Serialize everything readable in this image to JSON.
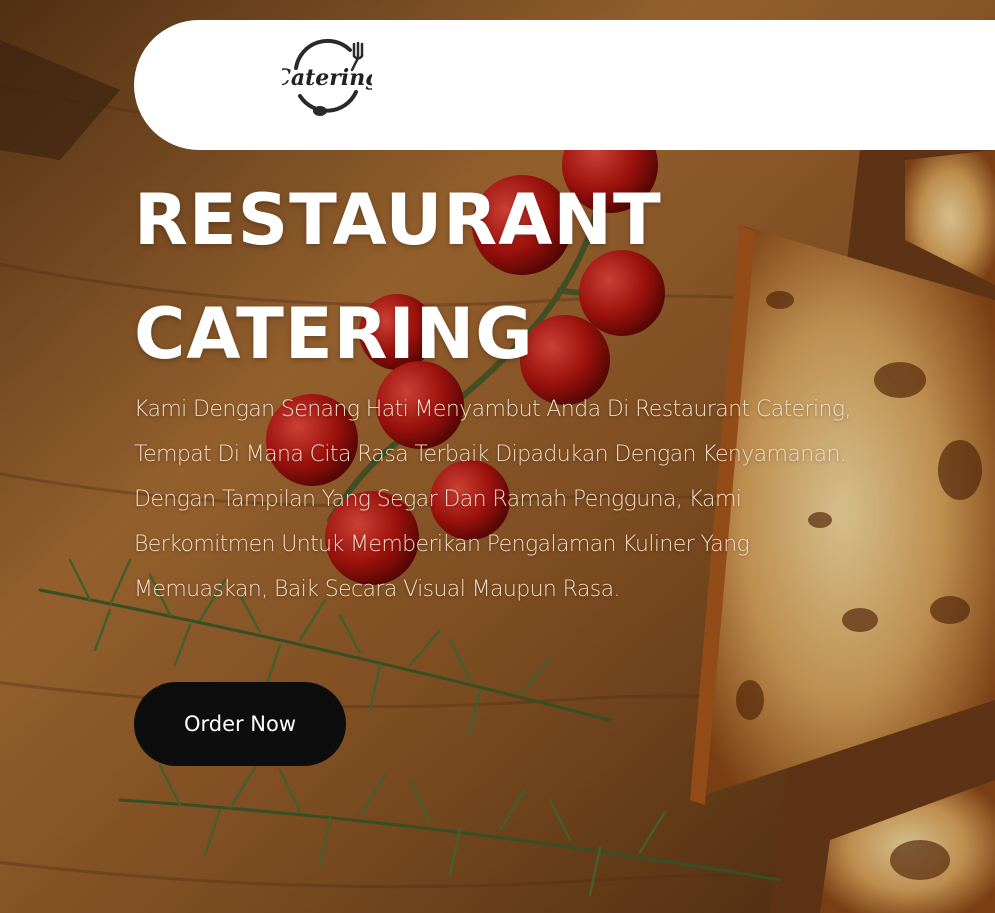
{
  "brand": {
    "logo_text": "Catering"
  },
  "hero": {
    "title_line1": "RESTAURANT",
    "title_line2": "CATERING",
    "description": "Kami Dengan Senang Hati Menyambut Anda Di Restaurant Catering, Tempat Di Mana Cita Rasa Terbaik Dipadukan Dengan Kenyamanan. Dengan Tampilan Yang Segar Dan Ramah Pengguna, Kami Berkomitmen Untuk Memberikan Pengalaman Kuliner Yang Memuaskan, Baik Secara Visual Maupun Rasa.",
    "cta_label": "Order Now"
  },
  "colors": {
    "nav_background": "#ffffff",
    "button_background": "#0d0d0d",
    "title_text": "#ffffff",
    "body_text": "#f3dcc6",
    "wood": "#8a5a2e"
  }
}
